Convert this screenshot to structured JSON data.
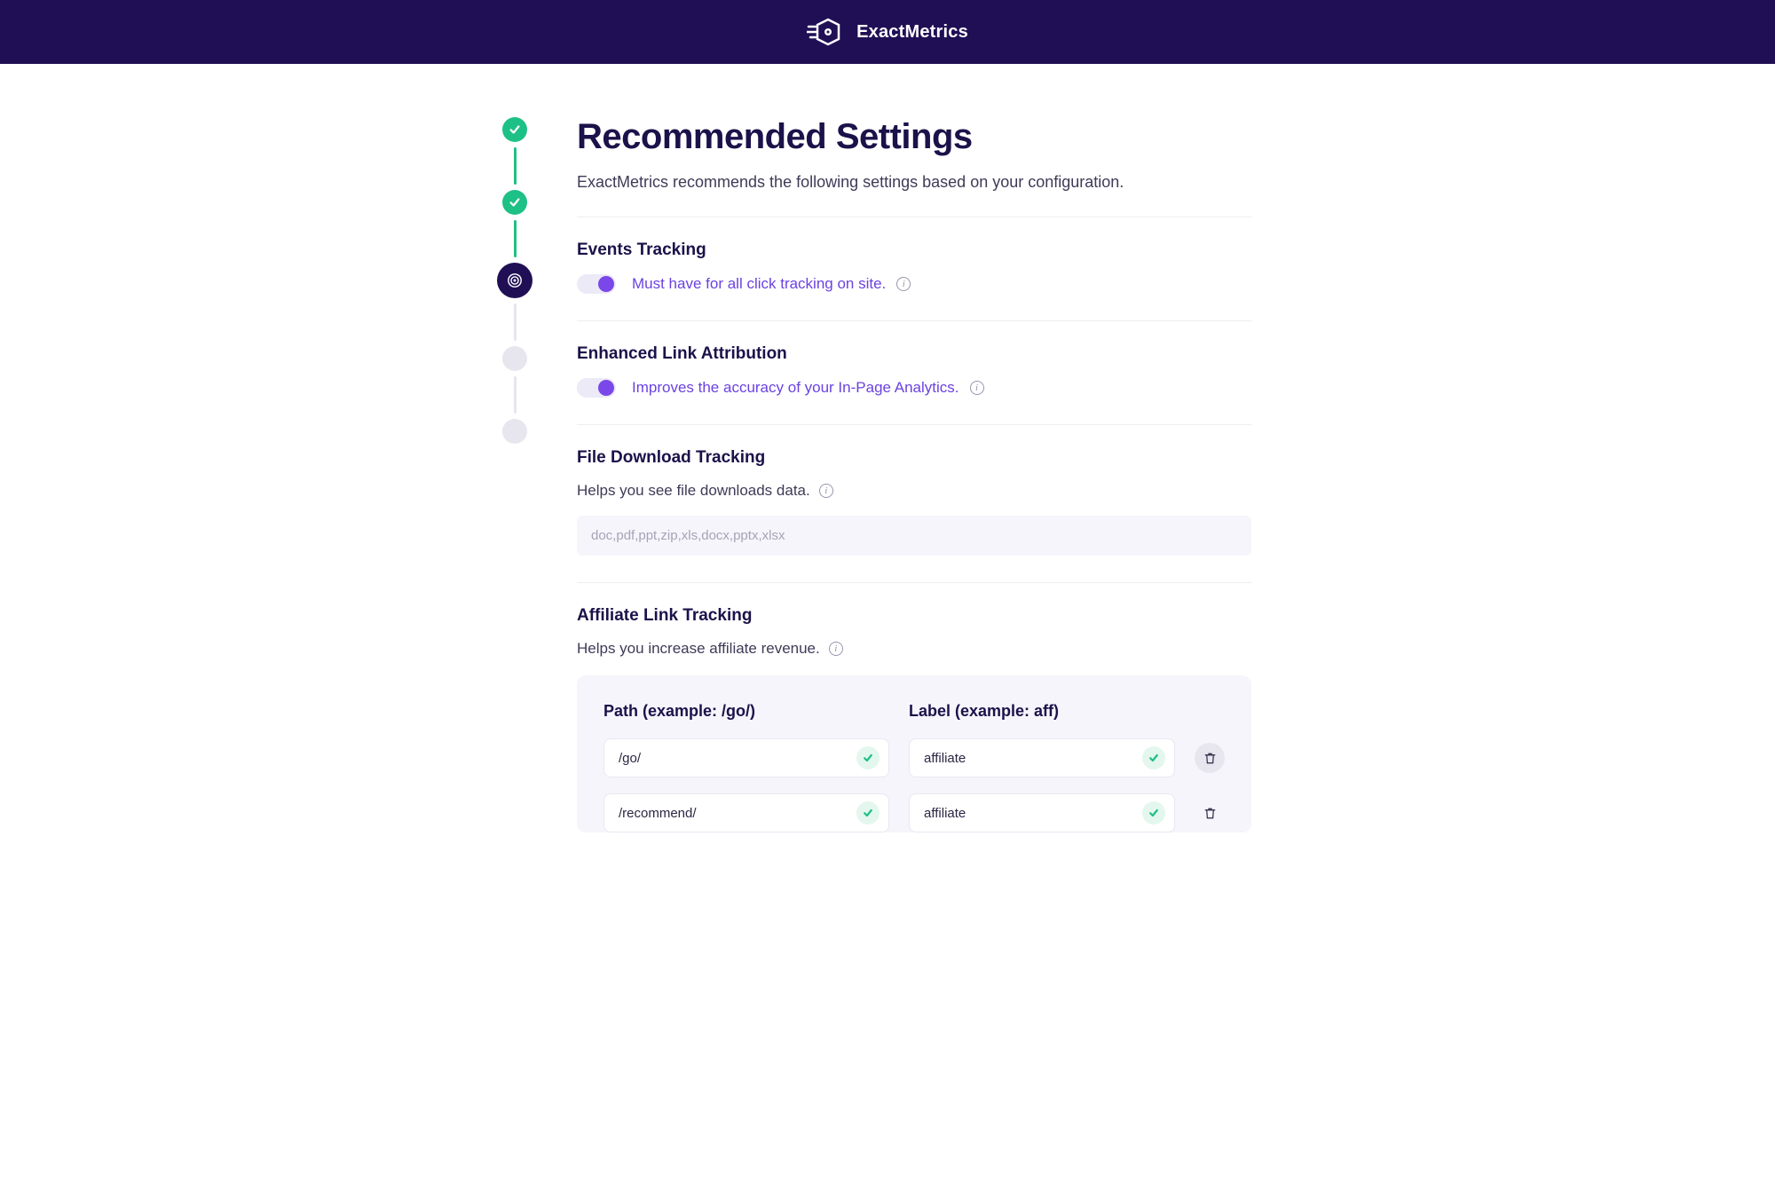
{
  "brand": {
    "name": "ExactMetrics",
    "bold_part": "Exact",
    "light_part": "Metrics"
  },
  "page": {
    "title": "Recommended Settings",
    "subtitle": "ExactMetrics recommends the following settings based on your configuration."
  },
  "stepper": {
    "steps": [
      {
        "state": "done"
      },
      {
        "state": "done"
      },
      {
        "state": "current"
      },
      {
        "state": "pending"
      },
      {
        "state": "pending"
      }
    ]
  },
  "sections": {
    "events": {
      "title": "Events Tracking",
      "toggle_on": true,
      "label": "Must have for all click tracking on site."
    },
    "enhanced": {
      "title": "Enhanced Link Attribution",
      "toggle_on": true,
      "label": "Improves the accuracy of your In-Page Analytics."
    },
    "downloads": {
      "title": "File Download Tracking",
      "desc": "Helps you see file downloads data.",
      "value": "doc,pdf,ppt,zip,xls,docx,pptx,xlsx"
    },
    "affiliate": {
      "title": "Affiliate Link Tracking",
      "desc": "Helps you increase affiliate revenue.",
      "col_path": "Path (example: /go/)",
      "col_label": "Label (example: aff)",
      "rows": [
        {
          "path": "/go/",
          "label": "affiliate"
        },
        {
          "path": "/recommend/",
          "label": "affiliate"
        }
      ]
    }
  }
}
